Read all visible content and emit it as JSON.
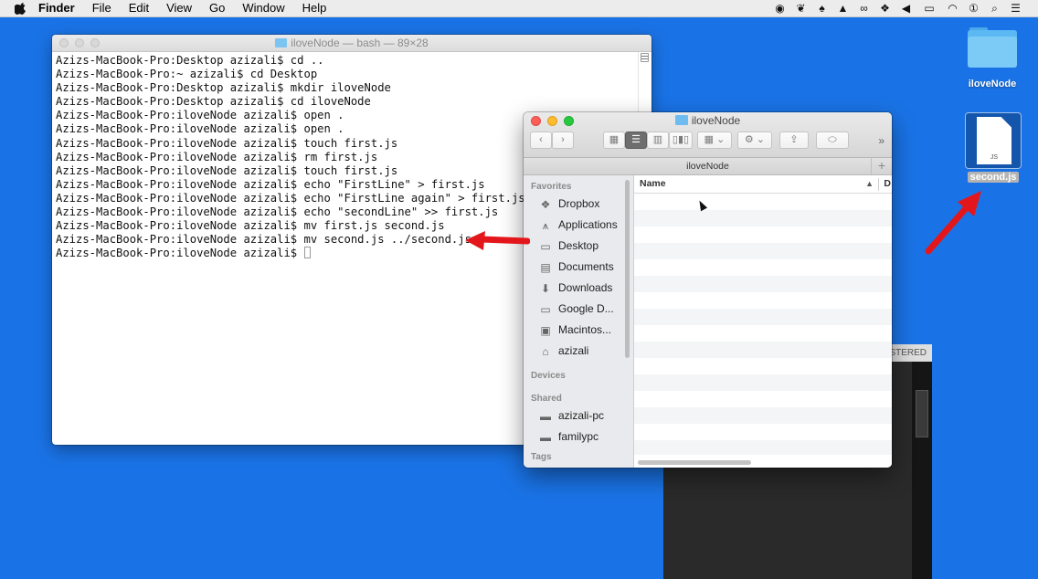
{
  "menubar": {
    "app": "Finder",
    "items": [
      "File",
      "Edit",
      "View",
      "Go",
      "Window",
      "Help"
    ]
  },
  "terminal": {
    "title": "iloveNode — bash — 89×28",
    "lines": [
      "Azizs-MacBook-Pro:Desktop azizali$ cd ..",
      "Azizs-MacBook-Pro:~ azizali$ cd Desktop",
      "Azizs-MacBook-Pro:Desktop azizali$ mkdir iloveNode",
      "Azizs-MacBook-Pro:Desktop azizali$ cd iloveNode",
      "Azizs-MacBook-Pro:iloveNode azizali$ open .",
      "Azizs-MacBook-Pro:iloveNode azizali$ open .",
      "Azizs-MacBook-Pro:iloveNode azizali$ touch first.js",
      "Azizs-MacBook-Pro:iloveNode azizali$ rm first.js",
      "Azizs-MacBook-Pro:iloveNode azizali$ touch first.js",
      "Azizs-MacBook-Pro:iloveNode azizali$ echo \"FirstLine\" > first.js",
      "Azizs-MacBook-Pro:iloveNode azizali$ echo \"FirstLine again\" > first.js",
      "Azizs-MacBook-Pro:iloveNode azizali$ echo \"secondLine\" >> first.js",
      "Azizs-MacBook-Pro:iloveNode azizali$ mv first.js second.js",
      "Azizs-MacBook-Pro:iloveNode azizali$ mv second.js ../second.js"
    ],
    "prompt": "Azizs-MacBook-Pro:iloveNode azizali$ "
  },
  "finder": {
    "title": "iloveNode",
    "path": "iloveNode",
    "column_name": "Name",
    "column_extra": "D",
    "sidebar": {
      "favorites_label": "Favorites",
      "favorites": [
        {
          "label": "Dropbox",
          "icon": "dropbox-icon"
        },
        {
          "label": "Applications",
          "icon": "applications-icon"
        },
        {
          "label": "Desktop",
          "icon": "desktop-icon"
        },
        {
          "label": "Documents",
          "icon": "documents-icon"
        },
        {
          "label": "Downloads",
          "icon": "downloads-icon"
        },
        {
          "label": "Google D...",
          "icon": "folder-icon"
        },
        {
          "label": "Macintos...",
          "icon": "hard-drive-icon"
        },
        {
          "label": "azizali",
          "icon": "home-icon"
        }
      ],
      "devices_label": "Devices",
      "shared_label": "Shared",
      "shared": [
        {
          "label": "azizali-pc",
          "icon": "computer-icon"
        },
        {
          "label": "familypc",
          "icon": "computer-icon"
        }
      ],
      "tags_label": "Tags"
    }
  },
  "darkwin": {
    "title_fragment": "STERED"
  },
  "desktop": {
    "folder_label": "iloveNode",
    "file_label": "second.js",
    "file_badge": "JS"
  },
  "colors": {
    "desktop": "#1a73e6",
    "arrow": "#e3171b"
  }
}
